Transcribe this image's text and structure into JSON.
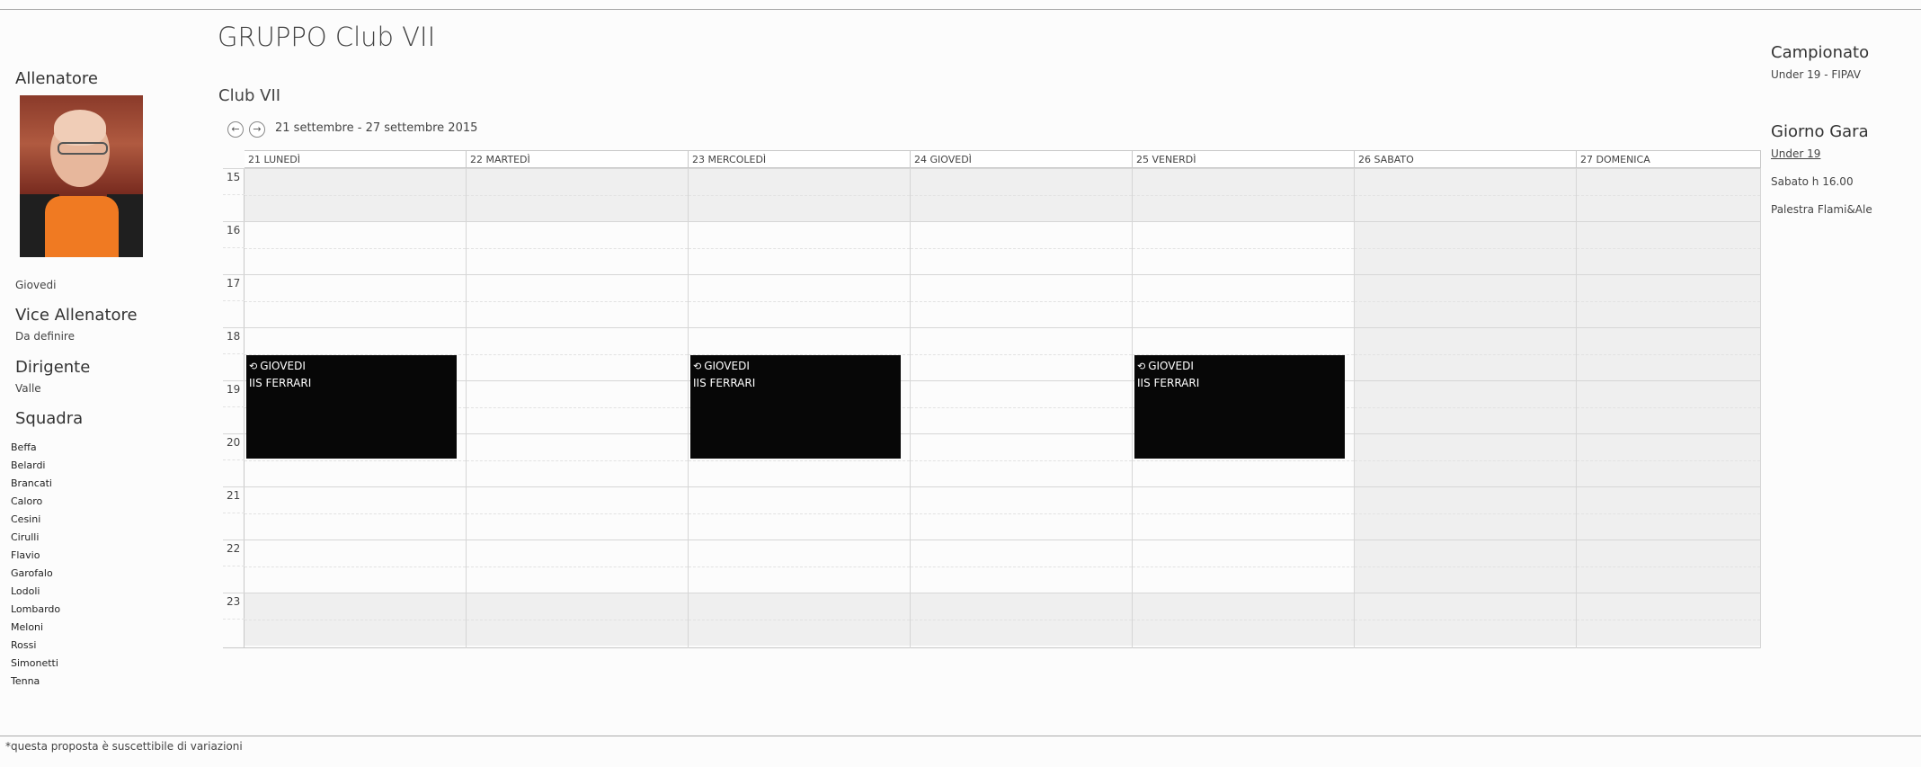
{
  "page": {
    "title": "GRUPPO Club VII",
    "subtitle": "Club VII",
    "date_range": "21 settembre - 27 settembre 2015",
    "footnote": "*questa proposta è suscettibile di variazioni"
  },
  "nav": {
    "prev_icon": "arrow-left-icon",
    "next_icon": "arrow-right-icon",
    "prev_glyph": "←",
    "next_glyph": "→"
  },
  "sidebar": {
    "coach_heading": "Allenatore",
    "coach_day": "Giovedi",
    "vice_heading": "Vice Allenatore",
    "vice_value": "Da definire",
    "director_heading": "Dirigente",
    "director_value": "Valle",
    "team_heading": "Squadra",
    "team": [
      "Beffa",
      "Belardi",
      "Brancati",
      "Caloro",
      "Cesini",
      "Cirulli",
      "Flavio",
      "Garofalo",
      "Lodoli",
      "Lombardo",
      "Meloni",
      "Rossi",
      "Simonetti",
      "Tenna"
    ]
  },
  "calendar": {
    "days": [
      "21 LUNEDÌ",
      "22 MARTEDÌ",
      "23 MERCOLEDÌ",
      "24 GIOVEDÌ",
      "25 VENERDÌ",
      "26 SABATO",
      "27 DOMENICA"
    ],
    "hours": [
      "15",
      "16",
      "17",
      "18",
      "19",
      "20",
      "21",
      "22",
      "23"
    ],
    "events": [
      {
        "day": 0,
        "title": "GIOVEDI",
        "location": "IIS FERRARI",
        "icon": "recurring-icon"
      },
      {
        "day": 2,
        "title": "GIOVEDI",
        "location": "IIS FERRARI",
        "icon": "recurring-icon"
      },
      {
        "day": 4,
        "title": "GIOVEDI",
        "location": "IIS FERRARI",
        "icon": "recurring-icon"
      }
    ]
  },
  "right": {
    "championship_heading": "Campionato",
    "championship_value": "Under 19 - FIPAV",
    "matchday_heading": "Giorno Gara",
    "matchday_link": "Under 19",
    "matchday_time": "Sabato h 16.00",
    "matchday_place": "Palestra Flami&Ale"
  },
  "colors": {
    "event_bg": "#070707",
    "shade": "#efefef",
    "grid_line": "#d6d6d6"
  }
}
